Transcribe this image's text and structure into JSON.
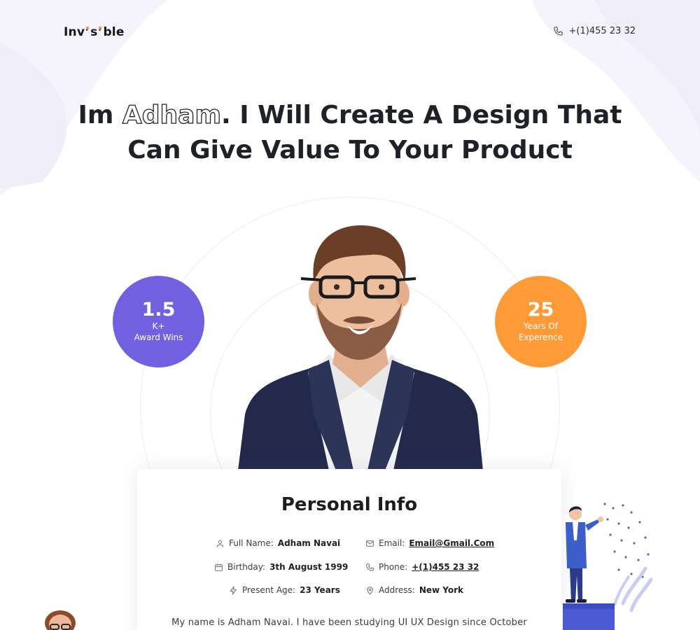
{
  "brand": {
    "name_part1": "Inv",
    "name_part2": "s",
    "name_part3": "ble"
  },
  "header": {
    "phone": "+(1)455 23 32",
    "phone_icon": "phone-icon"
  },
  "hero": {
    "prefix": "Im ",
    "name": "Adham",
    "line1_rest": ". I Will Create A Design That",
    "line2": "Can Give Value To Your Product"
  },
  "stats": {
    "awards": {
      "number": "1.5",
      "suffix": "K+",
      "label": "Award Wins"
    },
    "experience": {
      "number": "25",
      "label_line1": "Years Of",
      "label_line2": "Experence"
    }
  },
  "personal_info": {
    "title": "Personal Info",
    "full_name_label": "Full Name:",
    "full_name": "Adham Navai",
    "birthday_label": "Birthday:",
    "birthday": "3th August 1999",
    "age_label": "Present Age:",
    "age": "23 Years",
    "email_label": "Email:",
    "email": "Email@Gmail.Com",
    "phone_label": "Phone:",
    "phone": "+(1)455 23 32",
    "address_label": "Address:",
    "address": "New York",
    "bio": "My name is Adham Navai. I have been studying UI UX Design since October"
  },
  "colors": {
    "accent_purple": "#7160e0",
    "accent_orange": "#ff9b37",
    "text_dark": "#1e2228"
  }
}
